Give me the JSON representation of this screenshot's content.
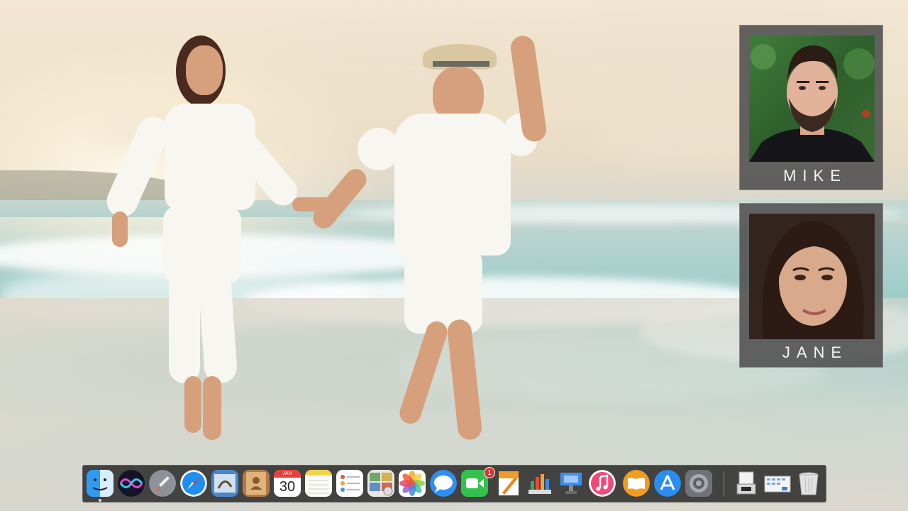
{
  "participants": [
    {
      "name": "MIKE"
    },
    {
      "name": "JANE"
    }
  ],
  "dock": {
    "items": [
      {
        "name": "Finder",
        "icon": "finder-icon",
        "running": true
      },
      {
        "name": "Siri",
        "icon": "siri-icon"
      },
      {
        "name": "Launchpad",
        "icon": "launchpad-icon"
      },
      {
        "name": "Safari",
        "icon": "safari-icon"
      },
      {
        "name": "Mail",
        "icon": "mail-icon"
      },
      {
        "name": "Contacts",
        "icon": "contacts-icon"
      },
      {
        "name": "Calendar",
        "icon": "calendar-icon",
        "month": "JAN",
        "day": "30"
      },
      {
        "name": "Notes",
        "icon": "notes-icon"
      },
      {
        "name": "Reminders",
        "icon": "reminders-icon"
      },
      {
        "name": "Photo Booth",
        "icon": "photo-booth-icon"
      },
      {
        "name": "Photos",
        "icon": "photos-icon"
      },
      {
        "name": "Messages",
        "icon": "messages-icon"
      },
      {
        "name": "FaceTime",
        "icon": "facetime-icon",
        "badge": "1"
      },
      {
        "name": "Pages",
        "icon": "pages-icon"
      },
      {
        "name": "Numbers",
        "icon": "numbers-icon"
      },
      {
        "name": "Keynote",
        "icon": "keynote-icon"
      },
      {
        "name": "iTunes",
        "icon": "itunes-icon"
      },
      {
        "name": "iBooks",
        "icon": "ibooks-icon"
      },
      {
        "name": "App Store",
        "icon": "app-store-icon"
      },
      {
        "name": "System Preferences",
        "icon": "system-preferences-icon"
      },
      {
        "name": "Downloads",
        "icon": "downloads-stack-icon"
      },
      {
        "name": "Documents",
        "icon": "documents-stack-icon"
      },
      {
        "name": "Trash",
        "icon": "trash-icon"
      }
    ]
  }
}
